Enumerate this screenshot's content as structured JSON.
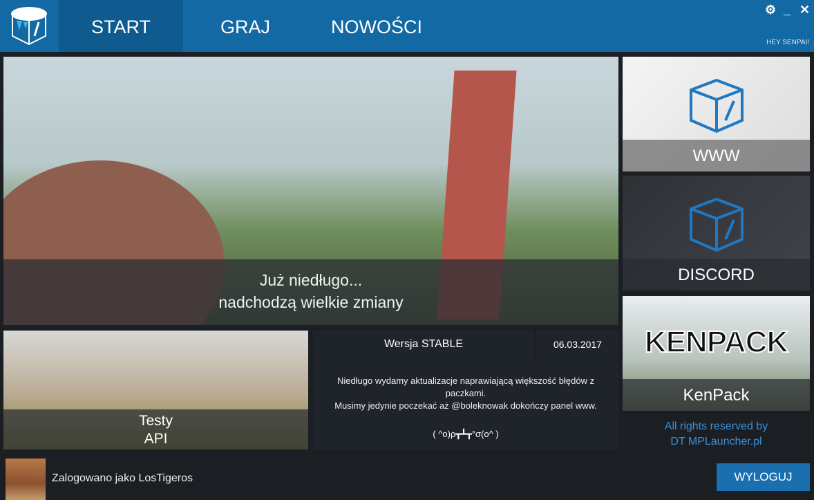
{
  "header": {
    "tabs": [
      {
        "label": "START",
        "active": true
      },
      {
        "label": "GRAJ"
      },
      {
        "label": "NOWOŚCI"
      }
    ],
    "greeting": "HEY SENPAI!",
    "accent": "#1269a3"
  },
  "hero": {
    "line1": "Już niedługo...",
    "line2": "nadchodzą wielkie zmiany"
  },
  "testy": {
    "line1": "Testy",
    "line2": "API"
  },
  "news": {
    "version": "Wersja STABLE",
    "date": "06.03.2017",
    "body_line1": "Niedługo wydamy aktualizacje naprawiającą większość błędów z paczkami.",
    "body_line2": "Musimy jedynie poczekać aż @boleknowak dokończy panel www.",
    "emote": "( ^o)ρ┳┻┳°σ(o^ )"
  },
  "side": {
    "www": "WWW",
    "discord": "DISCORD",
    "kenpack": "KenPack",
    "kenpack_logo": "KENPACK"
  },
  "rights": {
    "line1": "All rights reserved by",
    "line2": "DT MPLauncher.pl"
  },
  "footer": {
    "user_text": "Zalogowano jako LosTigeros",
    "logout": "WYLOGUJ"
  }
}
